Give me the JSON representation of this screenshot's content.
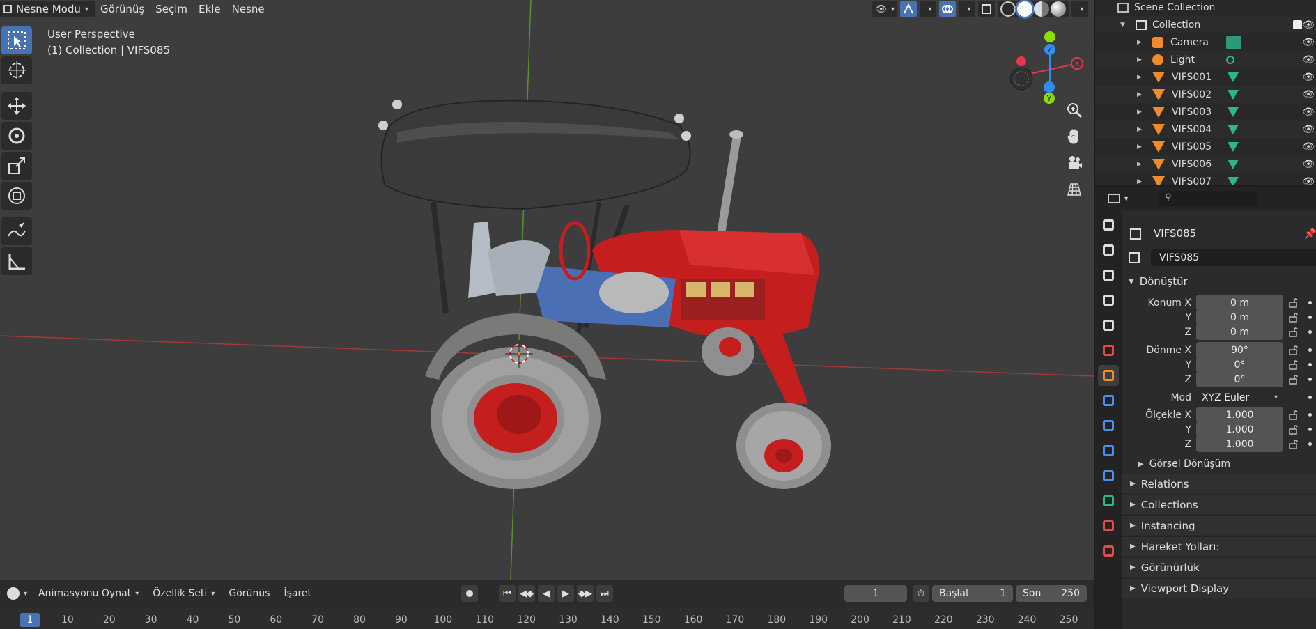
{
  "viewport": {
    "mode_label": "Nesne Modu",
    "menus": [
      "Görünüş",
      "Seçim",
      "Ekle",
      "Nesne"
    ],
    "perspective": "User Perspective",
    "collection_info": "(1) Collection | VIFS085",
    "gizmo_axes": {
      "x": "X",
      "y": "Y",
      "z": "Z"
    }
  },
  "toolbar": {
    "tools": [
      "select-box",
      "cursor",
      "move",
      "rotate",
      "scale",
      "transform",
      "annotate",
      "measure"
    ]
  },
  "timeline": {
    "menus": [
      "Animasyonu Oynat",
      "Özellik Seti",
      "Görünüş",
      "İşaret"
    ],
    "current_frame": "1",
    "start_label": "Başlat",
    "start_value": "1",
    "end_label": "Son",
    "end_value": "250",
    "ruler_current": "1",
    "ruler_ticks": [
      "10",
      "20",
      "30",
      "40",
      "50",
      "60",
      "70",
      "80",
      "90",
      "100",
      "110",
      "120",
      "130",
      "140",
      "150",
      "160",
      "170",
      "180",
      "190",
      "200",
      "210",
      "220",
      "230",
      "240",
      "250"
    ]
  },
  "outliner": {
    "scene_collection": "Scene Collection",
    "collection": "Collection",
    "items": [
      "Camera",
      "Light",
      "VIFS001",
      "VIFS002",
      "VIFS003",
      "VIFS004",
      "VIFS005",
      "VIFS006",
      "VIFS007"
    ]
  },
  "properties": {
    "object_name": "VIFS085",
    "name_field": "VIFS085",
    "transform_title": "Dönüştür",
    "location": {
      "label_x": "Konum X",
      "label_y": "Y",
      "label_z": "Z",
      "x": "0 m",
      "y": "0 m",
      "z": "0 m"
    },
    "rotation": {
      "label_x": "Dönme X",
      "label_y": "Y",
      "label_z": "Z",
      "x": "90°",
      "y": "0°",
      "z": "0°"
    },
    "mode": {
      "label": "Mod",
      "value": "XYZ Euler"
    },
    "scale": {
      "label_x": "Ölçekle X",
      "label_y": "Y",
      "label_z": "Z",
      "x": "1.000",
      "y": "1.000",
      "z": "1.000"
    },
    "delta_transform": "Görsel Dönüşüm",
    "panels": [
      "Relations",
      "Collections",
      "Instancing",
      "Hareket Yolları:",
      "Görünürlük",
      "Viewport Display"
    ]
  },
  "colors": {
    "accent": "#4772b3",
    "tractor_red": "#c01c1c",
    "axis_x": "#e8364f",
    "axis_y": "#8bdc00",
    "axis_z": "#2e8ef5"
  }
}
